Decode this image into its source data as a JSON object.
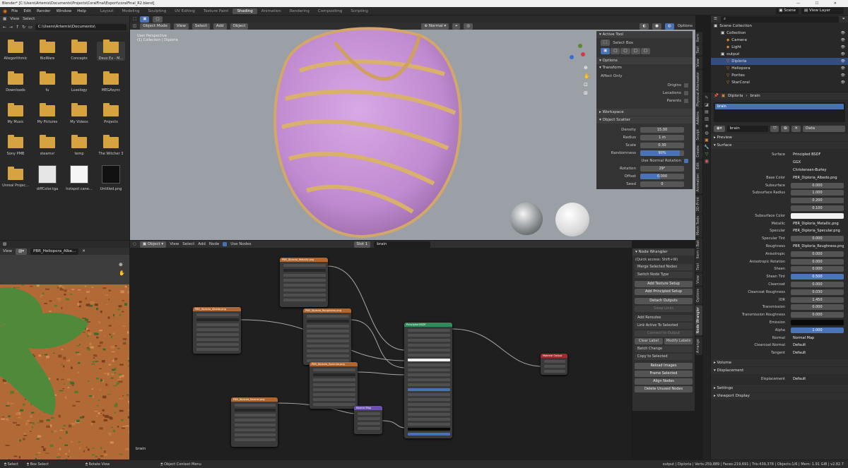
{
  "window_title": "Blender* [C:\\Users\\Artemis\\Documents\\Projects\\CoralFinal\\Export\\coralFinal_R2.blend]",
  "menu": [
    "File",
    "Edit",
    "Render",
    "Window",
    "Help"
  ],
  "workspaces": [
    "Layout",
    "Modeling",
    "Sculpting",
    "UV Editing",
    "Texture Paint",
    "Shading",
    "Animation",
    "Rendering",
    "Compositing",
    "Scripting"
  ],
  "active_workspace": "Shading",
  "scene": {
    "label": "Scene",
    "view_layer": "View Layer"
  },
  "file_browser": {
    "menus": [
      "View",
      "Select"
    ],
    "path": "C:\\Users\\Artemis\\Documents\\",
    "items": [
      {
        "name": "Allegorithmic",
        "type": "folder"
      },
      {
        "name": "BioWare",
        "type": "folder"
      },
      {
        "name": "Concepts",
        "type": "folder"
      },
      {
        "name": "Deus Ex - M...",
        "type": "folder"
      },
      {
        "name": "Downloads",
        "type": "folder"
      },
      {
        "name": "fu",
        "type": "folder"
      },
      {
        "name": "Luxology",
        "type": "folder"
      },
      {
        "name": "MEGAsync",
        "type": "folder"
      },
      {
        "name": "My Music",
        "type": "folder"
      },
      {
        "name": "My Pictures",
        "type": "folder"
      },
      {
        "name": "My Videos",
        "type": "folder"
      },
      {
        "name": "Projects",
        "type": "folder"
      },
      {
        "name": "Sony PMB",
        "type": "folder"
      },
      {
        "name": "steamvr",
        "type": "folder"
      },
      {
        "name": "temp",
        "type": "folder"
      },
      {
        "name": "The Witcher 3",
        "type": "folder"
      },
      {
        "name": "Unreal Projec...",
        "type": "folder"
      },
      {
        "name": "diffColor.tga",
        "type": "image"
      },
      {
        "name": "hotspot cane...",
        "type": "image"
      },
      {
        "name": "Untitled.png",
        "type": "image"
      }
    ]
  },
  "viewport": {
    "mode": "Object Mode",
    "menus": [
      "View",
      "Select",
      "Add",
      "Object"
    ],
    "shading": "Normal",
    "options": "Options",
    "overlay_text": [
      "User Perspective",
      "(1) Collection | Diploria"
    ]
  },
  "tool_panel": {
    "active_tool": "Active Tool",
    "tool": "Select Box",
    "options": "Options",
    "transform": "Transform",
    "affect_only": "Affect Only",
    "checks": [
      "Origins",
      "Locations",
      "Parents"
    ],
    "workspace": "Workspace",
    "object_scatter": "Object Scatter",
    "fields": [
      {
        "label": "Density",
        "value": "15.00"
      },
      {
        "label": "Radius",
        "value": "1 m"
      },
      {
        "label": "Scale",
        "value": "0.30"
      },
      {
        "label": "Randomness",
        "value": "90%"
      },
      {
        "label": "Rotation",
        "value": "29°"
      },
      {
        "label": "Offset",
        "value": "0.000"
      },
      {
        "label": "Seed",
        "value": "0"
      }
    ],
    "use_normal_rotation": "Use Normal Rotation"
  },
  "right_tabs": [
    "Item",
    "Tool",
    "View",
    "Physical Attenuator",
    "Addons",
    "Sculpt",
    "Create",
    "Edit",
    "Animation",
    "3D-Print",
    "Mesh Tools",
    "PBR Texture Bak"
  ],
  "outliner": {
    "root": "Scene Collection",
    "items": [
      {
        "name": "Collection",
        "depth": 1
      },
      {
        "name": "Camera",
        "depth": 2
      },
      {
        "name": "Light",
        "depth": 2
      },
      {
        "name": "output",
        "depth": 1
      },
      {
        "name": "Diploria",
        "depth": 2,
        "selected": true
      },
      {
        "name": "Heliopora",
        "depth": 2
      },
      {
        "name": "Porites",
        "depth": 2
      },
      {
        "name": "StarCoral",
        "depth": 2
      }
    ]
  },
  "properties": {
    "breadcrumb": [
      "Diploria",
      "brain"
    ],
    "material_slot": "brain",
    "material": "brain",
    "data": "Data",
    "preview": "Preview",
    "surface": "Surface",
    "rows": [
      {
        "label": "Surface",
        "value": "Principled BSDF",
        "dark": true
      },
      {
        "label": "",
        "value": "GGX",
        "dark": true
      },
      {
        "label": "",
        "value": "Christensen-Burley",
        "dark": true
      },
      {
        "label": "Base Color",
        "value": "PBR_Diploria_Albedo.png",
        "dark": true
      },
      {
        "label": "Subsurface",
        "value": "0.000"
      },
      {
        "label": "Subsurface Radius",
        "value": "1.000"
      },
      {
        "label": "",
        "value": "0.200"
      },
      {
        "label": "",
        "value": "0.100"
      },
      {
        "label": "Subsurface Color",
        "value": "",
        "color": "#f2f2f2"
      },
      {
        "label": "Metallic",
        "value": "PBR_Diploria_Metallic.png",
        "dark": true
      },
      {
        "label": "Specular",
        "value": "PBR_Diploria_Specular.png",
        "dark": true
      },
      {
        "label": "Specular Tint",
        "value": "0.000"
      },
      {
        "label": "Roughness",
        "value": "PBR_Diploria_Roughness.png",
        "dark": true
      },
      {
        "label": "Anisotropic",
        "value": "0.000"
      },
      {
        "label": "Anisotropic Rotation",
        "value": "0.000"
      },
      {
        "label": "Sheen",
        "value": "0.000"
      },
      {
        "label": "Sheen Tint",
        "value": "0.500",
        "color": "#4a76b8"
      },
      {
        "label": "Clearcoat",
        "value": "0.000"
      },
      {
        "label": "Clearcoat Roughness",
        "value": "0.030"
      },
      {
        "label": "IOR",
        "value": "1.450"
      },
      {
        "label": "Transmission",
        "value": "0.000"
      },
      {
        "label": "Transmission Roughness",
        "value": "0.000"
      },
      {
        "label": "Emission",
        "value": "",
        "color": "#0a0a0a"
      },
      {
        "label": "Alpha",
        "value": "1.000",
        "color": "#4a76b8"
      },
      {
        "label": "Normal",
        "value": "Normal Map",
        "dark": true
      },
      {
        "label": "Clearcoat Normal",
        "value": "Default",
        "dark": true
      },
      {
        "label": "Tangent",
        "value": "Default",
        "dark": true
      }
    ],
    "volume": "Volume",
    "displacement": "Displacement",
    "displacement_label": "Displacement",
    "displacement_value": "Default",
    "settings": "Settings",
    "viewport_display": "Viewport Display"
  },
  "image_editor": {
    "menus": [
      "View"
    ],
    "image": "PBR_Heliopora_Albe..."
  },
  "node_editor": {
    "type": "Object",
    "menus": [
      "View",
      "Select",
      "Add",
      "Node"
    ],
    "use_nodes": "Use Nodes",
    "slot": "Slot 1",
    "material": "brain",
    "footer": "brain"
  },
  "node_wrangler": {
    "title": "Node Wrangler",
    "quick": "(Quick access: Shift+W)",
    "items": [
      {
        "label": "Merge Selected Nodes",
        "kind": "menu"
      },
      {
        "label": "Switch Node Type",
        "kind": "menu"
      },
      {
        "label": "Add Texture Setup",
        "kind": "btn"
      },
      {
        "label": "Add Principled Setup",
        "kind": "btn"
      },
      {
        "label": "Detach Outputs",
        "kind": "btn"
      },
      {
        "label": "Swap Links",
        "kind": "dim"
      },
      {
        "label": "Add Reroutes",
        "kind": "menu"
      },
      {
        "label": "Link Active To Selected",
        "kind": "menu"
      },
      {
        "label": "Connect to Output",
        "kind": "dim"
      },
      {
        "label": "Clear Label",
        "kind": "half"
      },
      {
        "label": "Modify Labels",
        "kind": "half"
      },
      {
        "label": "Batch Change",
        "kind": "menu"
      },
      {
        "label": "Copy to Selected",
        "kind": "menu"
      },
      {
        "label": "Reload Images",
        "kind": "btn"
      },
      {
        "label": "Frame Selected",
        "kind": "btn"
      },
      {
        "label": "Align Nodes",
        "kind": "btn"
      },
      {
        "label": "Delete Unused Nodes",
        "kind": "btn"
      }
    ]
  },
  "nodes": [
    {
      "title": "PBR_Diploria_Metallic.png",
      "color": "#b0662e"
    },
    {
      "title": "PBR_Diploria_Albedo.png",
      "color": "#b0662e"
    },
    {
      "title": "PBR_Diploria_Roughness.png",
      "color": "#b0662e"
    },
    {
      "title": "PBR_Diploria_Specular.png",
      "color": "#b0662e"
    },
    {
      "title": "PBR_Diploria_Normal.png",
      "color": "#b0662e"
    },
    {
      "title": "Normal Map",
      "color": "#6b4fb5"
    },
    {
      "title": "Principled BSDF",
      "color": "#2f8c5a"
    },
    {
      "title": "Material Output",
      "color": "#a8282e"
    }
  ],
  "status": {
    "left": [
      "Select",
      "Box Select",
      "Rotate View",
      "Object Context Menu"
    ],
    "right": "output | Diploria | Verts:259,889 | Faces:219,691 | Tris:439,378 | Objects:1/6 | Mem: 1.91 GiB | v2.82.7"
  },
  "colors": {
    "accent": "#4772b3",
    "coral_pink": "#c89ad8",
    "coral_rim": "#d3a66a",
    "leaf_green": "#4e8a3a",
    "brown": "#b16a36"
  }
}
